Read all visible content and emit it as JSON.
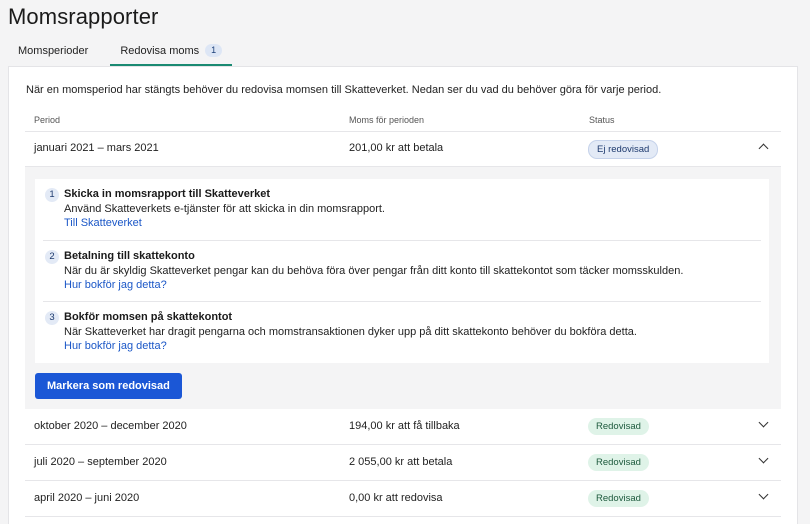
{
  "page": {
    "title": "Momsrapporter"
  },
  "tabs": [
    {
      "label": "Momsperioder"
    },
    {
      "label": "Redovisa moms",
      "badge": "1"
    }
  ],
  "intro": "När en momsperiod har stängts behöver du redovisa momsen till Skatteverket. Nedan ser du vad du behöver göra för varje period.",
  "table": {
    "columns": [
      "Period",
      "Moms för perioden",
      "Status"
    ],
    "rows": [
      {
        "period": "januari 2021 – mars 2021",
        "amount": "201,00 kr att betala",
        "status": "Ej redovisad",
        "status_color": "#e3eaf6",
        "expanded": true
      },
      {
        "period": "oktober 2020 – december 2020",
        "amount": "194,00 kr att få tillbaka",
        "status": "Redovisad",
        "status_color": "#dff3e8"
      },
      {
        "period": "juli 2020 – september 2020",
        "amount": "2 055,00 kr att betala",
        "status": "Redovisad",
        "status_color": "#dff3e8"
      },
      {
        "period": "april 2020 – juni 2020",
        "amount": "0,00 kr att redovisa",
        "status": "Redovisad",
        "status_color": "#dff3e8"
      }
    ]
  },
  "steps": [
    {
      "num": "1",
      "title": "Skicka in momsrapport till Skatteverket",
      "desc": "Använd Skatteverkets e-tjänster för att skicka in din momsrapport.",
      "link": "Till Skatteverket"
    },
    {
      "num": "2",
      "title": "Betalning till skattekonto",
      "desc": "När du är skyldig Skatteverket pengar kan du behöva föra över pengar från ditt konto till skattekontot som täcker momsskulden.",
      "link": "Hur bokför jag detta?"
    },
    {
      "num": "3",
      "title": "Bokför momsen på skattekontot",
      "desc": "När Skatteverket har dragit pengarna och momstransaktionen dyker upp på ditt skattekonto behöver du bokföra detta.",
      "link": "Hur bokför jag detta?"
    }
  ],
  "mark_button": "Markera som redovisad",
  "colors": {
    "accent": "#1b57d6",
    "tab_underline": "#1a8a72",
    "link": "#1b57c7"
  }
}
